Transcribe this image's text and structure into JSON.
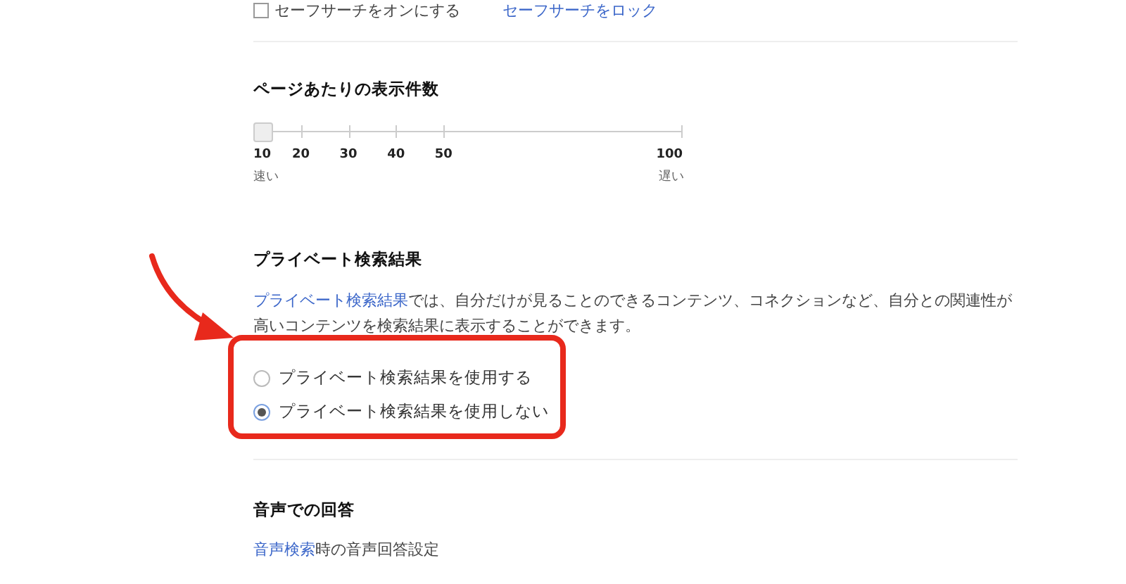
{
  "safe_search": {
    "checkbox": {
      "label": "セーフサーチをオンにする",
      "checked": false
    },
    "lock_link": "セーフサーチをロック"
  },
  "results_per_page": {
    "title": "ページあたりの表示件数",
    "slider": {
      "level": 0,
      "ticks": [
        "10",
        "20",
        "30",
        "40",
        "50",
        "100"
      ],
      "min_label": "速い",
      "max_label": "遅い"
    }
  },
  "private_results": {
    "title": "プライベート検索結果",
    "link": "プライベート検索結果",
    "description": "では、自分だけが見ることのできるコンテンツ、コネクションなど、自分との関連性が高いコンテンツを検索結果に表示することができます。",
    "options": [
      {
        "label": "プライベート検索結果を使用する",
        "selected": false
      },
      {
        "label": "プライベート検索結果を使用しない",
        "selected": true
      }
    ]
  },
  "voice_answers": {
    "title": "音声での回答",
    "link": "音声検索",
    "text": "時の音声回答設定"
  }
}
